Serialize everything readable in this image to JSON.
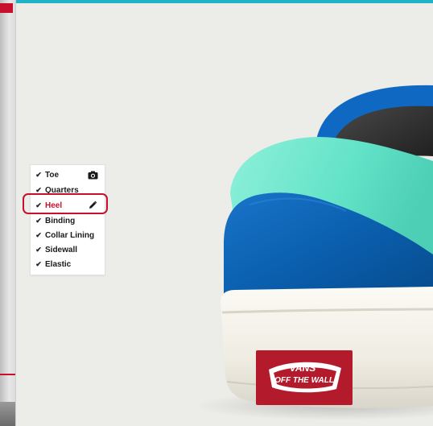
{
  "parts_menu": {
    "items": [
      {
        "label": "Toe",
        "checked": true,
        "tool_icon": "camera-icon",
        "active": false
      },
      {
        "label": "Quarters",
        "checked": true,
        "tool_icon": "",
        "active": false
      },
      {
        "label": "Heel",
        "checked": true,
        "tool_icon": "pencil-icon",
        "active": true
      },
      {
        "label": "Binding",
        "checked": true,
        "tool_icon": "",
        "active": false
      },
      {
        "label": "Collar Lining",
        "checked": true,
        "tool_icon": "",
        "active": false
      },
      {
        "label": "Sidewall",
        "checked": true,
        "tool_icon": "",
        "active": false
      },
      {
        "label": "Elastic",
        "checked": true,
        "tool_icon": "",
        "active": false
      }
    ],
    "check_glyph": "✔"
  },
  "heel_tag": {
    "brand_top": "VANS",
    "brand_bottom": "OFF THE WALL"
  },
  "colors": {
    "accent_top_bar": "#1fb3c7",
    "heel": "#0a5fae",
    "quarters": "#63e3c8",
    "collar_binding": "#0f69c2",
    "sidewall": "#f2efe6",
    "tag": "#b31b2c",
    "active_label": "#c8102e",
    "highlight_ring": "#c8102e",
    "background": "#ecece8"
  }
}
